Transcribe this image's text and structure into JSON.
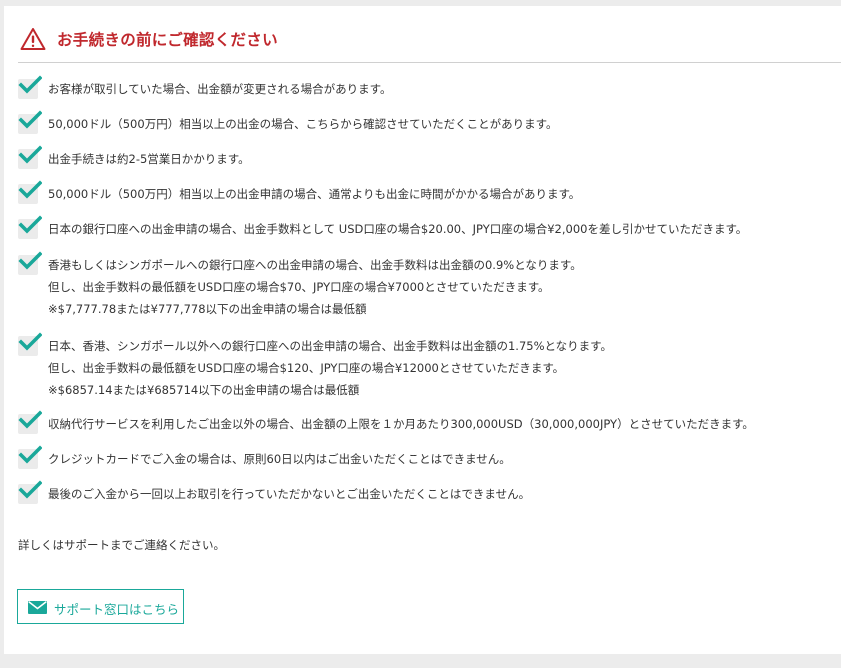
{
  "header": {
    "title": "お手続きの前にご確認ください",
    "icon": "warning-triangle-icon",
    "accent_color": "#c0282d"
  },
  "items": [
    {
      "lines": [
        "お客様が取引していた場合、出金額が変更される場合があります。"
      ]
    },
    {
      "lines": [
        "50,000ドル（500万円）相当以上の出金の場合、こちらから確認させていただくことがあります。"
      ]
    },
    {
      "lines": [
        "出金手続きは約2-5営業日かかります。"
      ]
    },
    {
      "lines": [
        "50,000ドル（500万円）相当以上の出金申請の場合、通常よりも出金に時間がかかる場合があります。"
      ]
    },
    {
      "lines": [
        "日本の銀行口座への出金申請の場合、出金手数料として USD口座の場合$20.00、JPY口座の場合¥2,000を差し引かせていただきます。"
      ]
    },
    {
      "lines": [
        "香港もしくはシンガポールへの銀行口座への出金申請の場合、出金手数料は出金額の0.9%となります。",
        "但し、出金手数料の最低額をUSD口座の場合$70、JPY口座の場合¥7000とさせていただきます。",
        "※$7,777.78または¥777,778以下の出金申請の場合は最低額"
      ]
    },
    {
      "lines": [
        "日本、香港、シンガポール以外への銀行口座への出金申請の場合、出金手数料は出金額の1.75%となります。",
        "但し、出金手数料の最低額をUSD口座の場合$120、JPY口座の場合¥12000とさせていただきます。",
        "※$6857.14または¥685714以下の出金申請の場合は最低額"
      ]
    },
    {
      "lines": [
        "収納代行サービスを利用したご出金以外の場合、出金額の上限を１か月あたり300,000USD（30,000,000JPY）とさせていただきます。"
      ]
    },
    {
      "lines": [
        "クレジットカードでご入金の場合は、原則60日以内はご出金いただくことはできません。"
      ]
    },
    {
      "lines": [
        "最後のご入金から一回以上お取引を行っていただかないとご出金いただくことはできません。"
      ]
    }
  ],
  "checkbox_icon": "checkmark-icon",
  "check_color": "#1aa89a",
  "note": "詳しくはサポートまでご連絡ください。",
  "support_button": {
    "label": "サポート窓口はこちら",
    "icon": "mail-icon"
  }
}
